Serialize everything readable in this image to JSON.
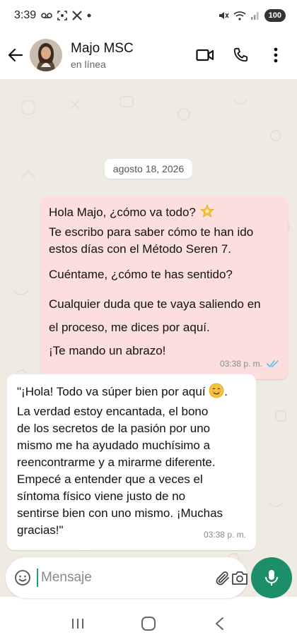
{
  "status_bar": {
    "time": "3:39",
    "battery": "100",
    "icons": [
      "voicemail-icon",
      "screenshot-icon",
      "x-app-icon",
      "dot-icon",
      "mute-icon",
      "wifi-icon",
      "signal-icon"
    ]
  },
  "header": {
    "contact_name": "Majo MSC",
    "contact_status": "en línea",
    "icons": [
      "back-arrow-icon",
      "avatar",
      "video-call-icon",
      "phone-icon",
      "more-vert-icon"
    ]
  },
  "chat": {
    "date_chip": "agosto 18, 2026",
    "outgoing": {
      "line1": "Hola Majo, ¿cómo va todo?",
      "line2": "Te escribo para saber cómo te han ido",
      "line3": "estos días con el Método Seren 7.",
      "para2": "Cuéntame, ¿cómo te has sentido?",
      "para3a": "Cualquier duda que te vaya saliendo en",
      "para3b": "el proceso, me dices por aquí.",
      "para4": "¡Te mando un abrazo!",
      "time": "03:38 p. m.",
      "status_icon": "double-check-icon",
      "emoji": "glowing-star"
    },
    "incoming": {
      "line1": "\"¡Hola! Todo va súper bien por aquí",
      "line2": "La verdad estoy encantada, el bono",
      "line3": "de los secretos de la pasión por uno",
      "line4": "mismo me ha ayudado muchísimo a",
      "line5": "reencontrarme y a mirarme diferente.",
      "line6": "Empecé a entender que a veces el",
      "line7": "síntoma físico viene justo de no",
      "line8": "sentirse bien con uno mismo. ¡Muchas",
      "line9": "gracias!\"",
      "time": "03:38 p. m.",
      "emoji": "smiling-face"
    }
  },
  "composer": {
    "placeholder": "Mensaje",
    "icons": [
      "emoji-icon",
      "attach-icon",
      "camera-icon",
      "mic-icon"
    ]
  },
  "navbar": {
    "icons": [
      "recent-apps-icon",
      "home-icon",
      "back-icon"
    ]
  },
  "colors": {
    "chat_bg": "#efeae2",
    "outgoing_bubble": "#fcdedd",
    "incoming_bubble": "#ffffff",
    "accent": "#1c8f6a",
    "read_check": "#53bdeb"
  }
}
